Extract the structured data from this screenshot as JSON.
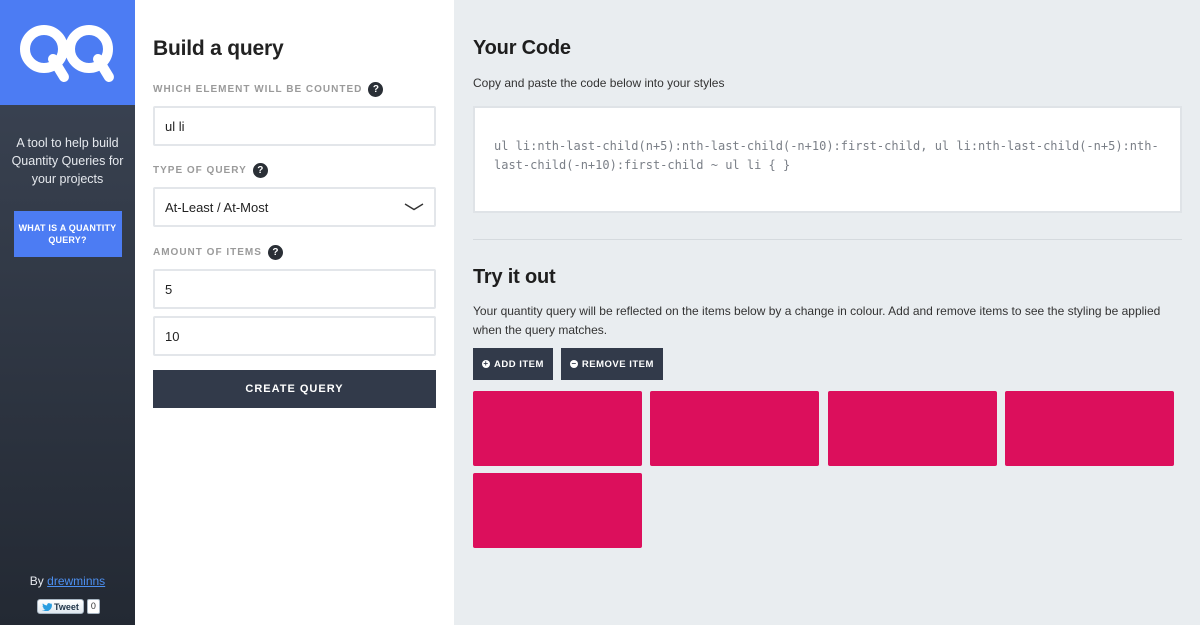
{
  "sidebar": {
    "tagline": "A tool to help build Quantity Queries for your projects",
    "what_button": "WHAT IS A QUANTITY QUERY?",
    "by_text": "By",
    "author_link": "drewminns",
    "tweet_label": "Tweet",
    "tweet_count": "0"
  },
  "form": {
    "title": "Build a query",
    "element_label": "WHICH ELEMENT WILL BE COUNTED",
    "element_value": "ul li",
    "query_type_label": "TYPE OF QUERY",
    "query_type_value": "At-Least / At-Most",
    "amount_label": "AMOUNT OF ITEMS",
    "amount_min": "5",
    "amount_max": "10",
    "create_button": "CREATE QUERY",
    "help_glyph": "?"
  },
  "code_section": {
    "title": "Your Code",
    "instruction": "Copy and paste the code below into your styles",
    "code": "ul li:nth-last-child(n+5):nth-last-child(-n+10):first-child, ul li:nth-last-child(-n+5):nth-last-child(-n+10):first-child ~ ul li { }"
  },
  "try_section": {
    "title": "Try it out",
    "description": "Your quantity query will be reflected on the items below by a change in colour. Add and remove items to see the styling be applied when the query matches.",
    "add_button": "ADD ITEM",
    "remove_button": "REMOVE ITEM",
    "item_count": 5,
    "item_color": "#dc0f5c"
  },
  "colors": {
    "accent": "#4c7cf3",
    "dark_button": "#323a4a",
    "item": "#dc0f5c"
  }
}
